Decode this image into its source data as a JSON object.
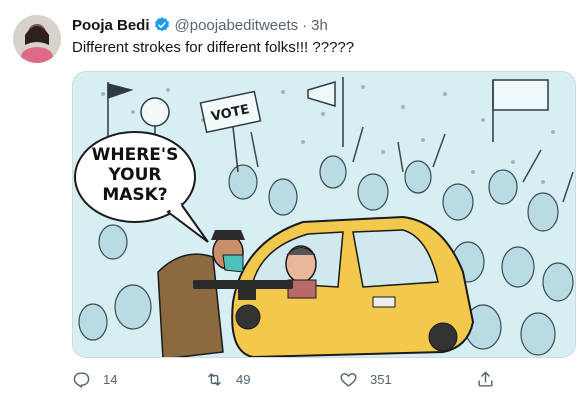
{
  "tweet": {
    "author_name": "Pooja Bedi",
    "handle": "@poojabeditweets",
    "separator": "·",
    "time": "3h",
    "text": "Different strokes for different folks!!! ?????",
    "image": {
      "speech_bubble": [
        "WHERE'S",
        "YOUR",
        "MASK?"
      ],
      "placard": "VOTE"
    },
    "counts": {
      "replies": "14",
      "retweets": "49",
      "likes": "351"
    }
  },
  "colors": {
    "verified": "#1d9bf0",
    "muted": "#536471",
    "cartoon_sky": "#d7eef3",
    "taxi": "#f2c94c"
  },
  "icons": {
    "reply": "reply-icon",
    "retweet": "retweet-icon",
    "like": "heart-icon",
    "share": "share-icon"
  }
}
